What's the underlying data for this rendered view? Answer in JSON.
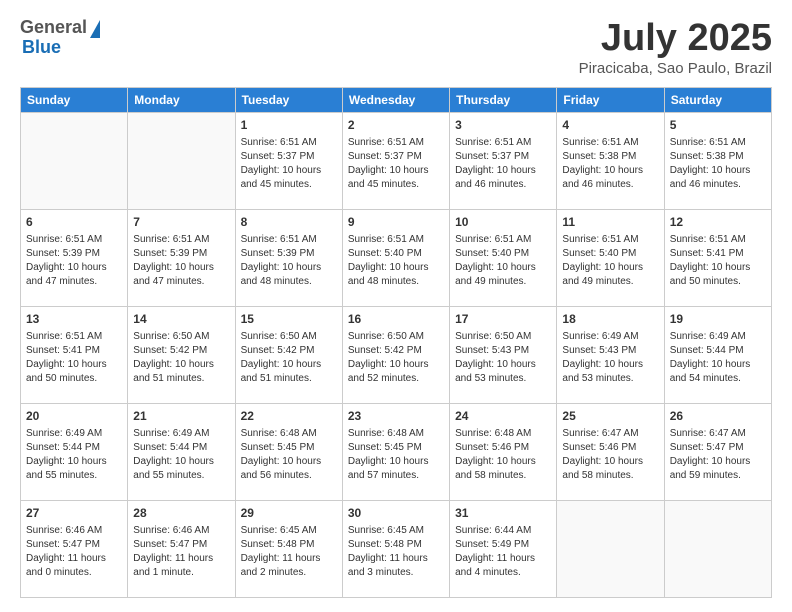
{
  "header": {
    "logo_general": "General",
    "logo_blue": "Blue",
    "title": "July 2025",
    "location": "Piracicaba, Sao Paulo, Brazil"
  },
  "days_of_week": [
    "Sunday",
    "Monday",
    "Tuesday",
    "Wednesday",
    "Thursday",
    "Friday",
    "Saturday"
  ],
  "weeks": [
    [
      {
        "day": "",
        "empty": true
      },
      {
        "day": "",
        "empty": true
      },
      {
        "day": "1",
        "sunrise": "Sunrise: 6:51 AM",
        "sunset": "Sunset: 5:37 PM",
        "daylight": "Daylight: 10 hours and 45 minutes."
      },
      {
        "day": "2",
        "sunrise": "Sunrise: 6:51 AM",
        "sunset": "Sunset: 5:37 PM",
        "daylight": "Daylight: 10 hours and 45 minutes."
      },
      {
        "day": "3",
        "sunrise": "Sunrise: 6:51 AM",
        "sunset": "Sunset: 5:37 PM",
        "daylight": "Daylight: 10 hours and 46 minutes."
      },
      {
        "day": "4",
        "sunrise": "Sunrise: 6:51 AM",
        "sunset": "Sunset: 5:38 PM",
        "daylight": "Daylight: 10 hours and 46 minutes."
      },
      {
        "day": "5",
        "sunrise": "Sunrise: 6:51 AM",
        "sunset": "Sunset: 5:38 PM",
        "daylight": "Daylight: 10 hours and 46 minutes."
      }
    ],
    [
      {
        "day": "6",
        "sunrise": "Sunrise: 6:51 AM",
        "sunset": "Sunset: 5:39 PM",
        "daylight": "Daylight: 10 hours and 47 minutes."
      },
      {
        "day": "7",
        "sunrise": "Sunrise: 6:51 AM",
        "sunset": "Sunset: 5:39 PM",
        "daylight": "Daylight: 10 hours and 47 minutes."
      },
      {
        "day": "8",
        "sunrise": "Sunrise: 6:51 AM",
        "sunset": "Sunset: 5:39 PM",
        "daylight": "Daylight: 10 hours and 48 minutes."
      },
      {
        "day": "9",
        "sunrise": "Sunrise: 6:51 AM",
        "sunset": "Sunset: 5:40 PM",
        "daylight": "Daylight: 10 hours and 48 minutes."
      },
      {
        "day": "10",
        "sunrise": "Sunrise: 6:51 AM",
        "sunset": "Sunset: 5:40 PM",
        "daylight": "Daylight: 10 hours and 49 minutes."
      },
      {
        "day": "11",
        "sunrise": "Sunrise: 6:51 AM",
        "sunset": "Sunset: 5:40 PM",
        "daylight": "Daylight: 10 hours and 49 minutes."
      },
      {
        "day": "12",
        "sunrise": "Sunrise: 6:51 AM",
        "sunset": "Sunset: 5:41 PM",
        "daylight": "Daylight: 10 hours and 50 minutes."
      }
    ],
    [
      {
        "day": "13",
        "sunrise": "Sunrise: 6:51 AM",
        "sunset": "Sunset: 5:41 PM",
        "daylight": "Daylight: 10 hours and 50 minutes."
      },
      {
        "day": "14",
        "sunrise": "Sunrise: 6:50 AM",
        "sunset": "Sunset: 5:42 PM",
        "daylight": "Daylight: 10 hours and 51 minutes."
      },
      {
        "day": "15",
        "sunrise": "Sunrise: 6:50 AM",
        "sunset": "Sunset: 5:42 PM",
        "daylight": "Daylight: 10 hours and 51 minutes."
      },
      {
        "day": "16",
        "sunrise": "Sunrise: 6:50 AM",
        "sunset": "Sunset: 5:42 PM",
        "daylight": "Daylight: 10 hours and 52 minutes."
      },
      {
        "day": "17",
        "sunrise": "Sunrise: 6:50 AM",
        "sunset": "Sunset: 5:43 PM",
        "daylight": "Daylight: 10 hours and 53 minutes."
      },
      {
        "day": "18",
        "sunrise": "Sunrise: 6:49 AM",
        "sunset": "Sunset: 5:43 PM",
        "daylight": "Daylight: 10 hours and 53 minutes."
      },
      {
        "day": "19",
        "sunrise": "Sunrise: 6:49 AM",
        "sunset": "Sunset: 5:44 PM",
        "daylight": "Daylight: 10 hours and 54 minutes."
      }
    ],
    [
      {
        "day": "20",
        "sunrise": "Sunrise: 6:49 AM",
        "sunset": "Sunset: 5:44 PM",
        "daylight": "Daylight: 10 hours and 55 minutes."
      },
      {
        "day": "21",
        "sunrise": "Sunrise: 6:49 AM",
        "sunset": "Sunset: 5:44 PM",
        "daylight": "Daylight: 10 hours and 55 minutes."
      },
      {
        "day": "22",
        "sunrise": "Sunrise: 6:48 AM",
        "sunset": "Sunset: 5:45 PM",
        "daylight": "Daylight: 10 hours and 56 minutes."
      },
      {
        "day": "23",
        "sunrise": "Sunrise: 6:48 AM",
        "sunset": "Sunset: 5:45 PM",
        "daylight": "Daylight: 10 hours and 57 minutes."
      },
      {
        "day": "24",
        "sunrise": "Sunrise: 6:48 AM",
        "sunset": "Sunset: 5:46 PM",
        "daylight": "Daylight: 10 hours and 58 minutes."
      },
      {
        "day": "25",
        "sunrise": "Sunrise: 6:47 AM",
        "sunset": "Sunset: 5:46 PM",
        "daylight": "Daylight: 10 hours and 58 minutes."
      },
      {
        "day": "26",
        "sunrise": "Sunrise: 6:47 AM",
        "sunset": "Sunset: 5:47 PM",
        "daylight": "Daylight: 10 hours and 59 minutes."
      }
    ],
    [
      {
        "day": "27",
        "sunrise": "Sunrise: 6:46 AM",
        "sunset": "Sunset: 5:47 PM",
        "daylight": "Daylight: 11 hours and 0 minutes."
      },
      {
        "day": "28",
        "sunrise": "Sunrise: 6:46 AM",
        "sunset": "Sunset: 5:47 PM",
        "daylight": "Daylight: 11 hours and 1 minute."
      },
      {
        "day": "29",
        "sunrise": "Sunrise: 6:45 AM",
        "sunset": "Sunset: 5:48 PM",
        "daylight": "Daylight: 11 hours and 2 minutes."
      },
      {
        "day": "30",
        "sunrise": "Sunrise: 6:45 AM",
        "sunset": "Sunset: 5:48 PM",
        "daylight": "Daylight: 11 hours and 3 minutes."
      },
      {
        "day": "31",
        "sunrise": "Sunrise: 6:44 AM",
        "sunset": "Sunset: 5:49 PM",
        "daylight": "Daylight: 11 hours and 4 minutes."
      },
      {
        "day": "",
        "empty": true
      },
      {
        "day": "",
        "empty": true
      }
    ]
  ]
}
